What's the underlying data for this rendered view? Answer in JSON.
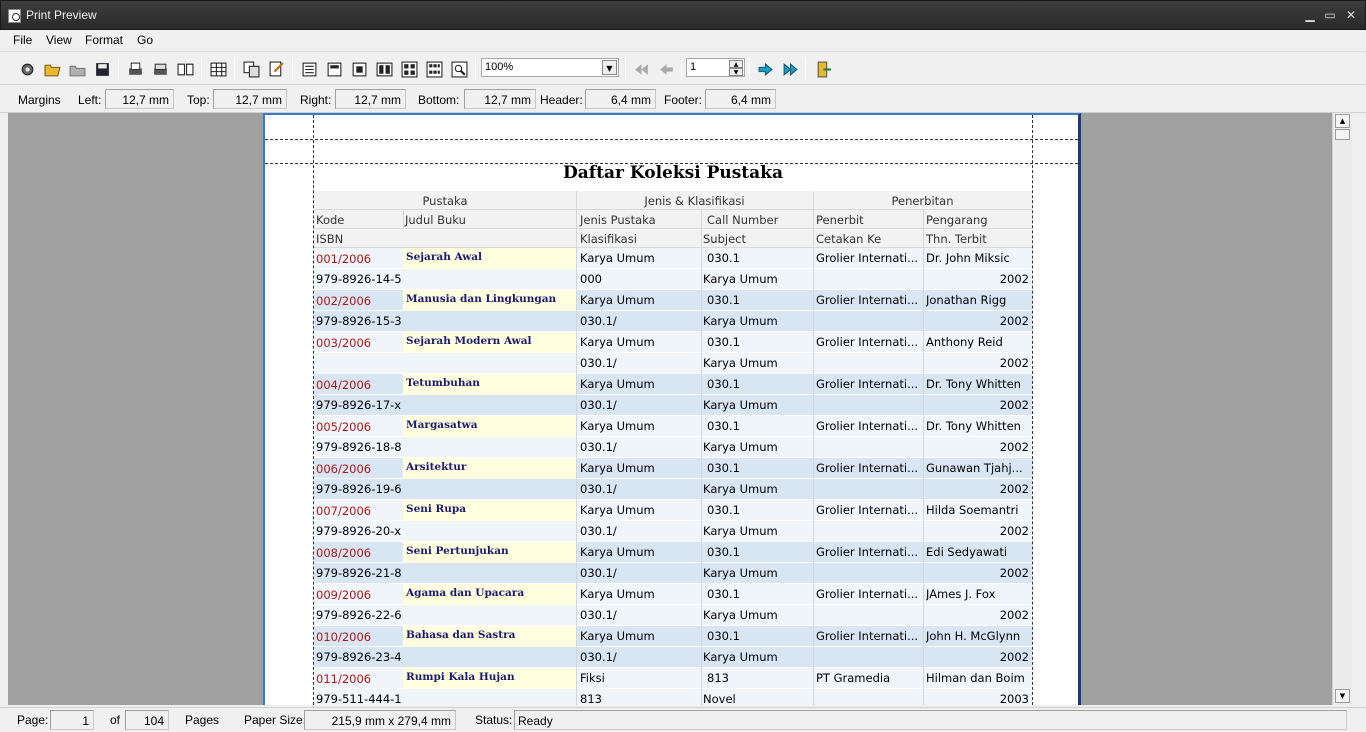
{
  "window": {
    "title": "Print Preview"
  },
  "menu": [
    "File",
    "View",
    "Format",
    "Go"
  ],
  "toolbar": {
    "zoom_value": "100%",
    "page_value": "1",
    "icons": [
      "settings-icon",
      "open-icon",
      "folder-icon",
      "save-icon",
      "print-icon",
      "print-setup-icon",
      "book-view-icon",
      "grid-icon",
      "copy-icon",
      "export-icon",
      "page-view-icon",
      "header-footer-icon",
      "single-page-icon",
      "two-pages-icon",
      "four-pages-icon",
      "multi-pages-icon",
      "zoom-fit-icon",
      "first-page-icon",
      "prev-page-icon",
      "next-page-icon",
      "last-page-icon",
      "exit-icon"
    ]
  },
  "margins": {
    "section_label": "Margins",
    "left_label": "Left:",
    "left_value": "12,7 mm",
    "top_label": "Top:",
    "top_value": "12,7 mm",
    "right_label": "Right:",
    "right_value": "12,7 mm",
    "bottom_label": "Bottom:",
    "bottom_value": "12,7 mm",
    "header_label": "Header:",
    "header_value": "6,4 mm",
    "footer_label": "Footer:",
    "footer_value": "6,4 mm"
  },
  "report": {
    "title": "Daftar Koleksi Pustaka",
    "groups": [
      "Pustaka",
      "Jenis & Klasifikasi",
      "Penerbitan"
    ],
    "header_row1": [
      "Kode",
      "Judul Buku",
      "Jenis Pustaka",
      "Call Number",
      "Penerbit",
      "Pengarang"
    ],
    "header_row2": [
      "ISBN",
      "Klasifikasi",
      "Subject",
      "Cetakan Ke",
      "Thn. Terbit"
    ],
    "records": [
      {
        "kode": "001/2006",
        "judul": "Sejarah Awal",
        "jenis": "Karya Umum",
        "call": "030.1",
        "penerbit": "Grolier Internati...",
        "pengarang": "Dr. John Miksic",
        "isbn": "979-8926-14-5",
        "klasifikasi": "000",
        "subject": "Karya Umum",
        "cetakan": "",
        "tahun": "2002"
      },
      {
        "kode": "002/2006",
        "judul": "Manusia dan Lingkungan",
        "jenis": "Karya Umum",
        "call": "030.1",
        "penerbit": "Grolier Internati...",
        "pengarang": "Jonathan Rigg",
        "isbn": "979-8926-15-3",
        "klasifikasi": "030.1/",
        "subject": "Karya Umum",
        "cetakan": "",
        "tahun": "2002"
      },
      {
        "kode": "003/2006",
        "judul": "Sejarah Modern Awal",
        "jenis": "Karya Umum",
        "call": "030.1",
        "penerbit": "Grolier Internati...",
        "pengarang": "Anthony Reid",
        "isbn": "",
        "klasifikasi": "030.1/",
        "subject": "Karya Umum",
        "cetakan": "",
        "tahun": "2002"
      },
      {
        "kode": "004/2006",
        "judul": "Tetumbuhan",
        "jenis": "Karya Umum",
        "call": "030.1",
        "penerbit": "Grolier Internati...",
        "pengarang": "Dr. Tony Whitten",
        "isbn": "979-8926-17-x",
        "klasifikasi": "030.1/",
        "subject": "Karya Umum",
        "cetakan": "",
        "tahun": "2002"
      },
      {
        "kode": "005/2006",
        "judul": "Margasatwa",
        "jenis": "Karya Umum",
        "call": "030.1",
        "penerbit": "Grolier Internati...",
        "pengarang": "Dr. Tony Whitten",
        "isbn": "979-8926-18-8",
        "klasifikasi": "030.1/",
        "subject": "Karya Umum",
        "cetakan": "",
        "tahun": "2002"
      },
      {
        "kode": "006/2006",
        "judul": "Arsitektur",
        "jenis": "Karya Umum",
        "call": "030.1",
        "penerbit": "Grolier Internati...",
        "pengarang": "Gunawan Tjahj...",
        "isbn": "979-8926-19-6",
        "klasifikasi": "030.1/",
        "subject": "Karya Umum",
        "cetakan": "",
        "tahun": "2002"
      },
      {
        "kode": "007/2006",
        "judul": "Seni Rupa",
        "jenis": "Karya Umum",
        "call": "030.1",
        "penerbit": "Grolier Internati...",
        "pengarang": "Hilda Soemantri",
        "isbn": "979-8926-20-x",
        "klasifikasi": "030.1/",
        "subject": "Karya Umum",
        "cetakan": "",
        "tahun": "2002"
      },
      {
        "kode": "008/2006",
        "judul": "Seni Pertunjukan",
        "jenis": "Karya Umum",
        "call": "030.1",
        "penerbit": "Grolier Internati...",
        "pengarang": "Edi Sedyawati",
        "isbn": "979-8926-21-8",
        "klasifikasi": "030.1/",
        "subject": "Karya Umum",
        "cetakan": "",
        "tahun": "2002"
      },
      {
        "kode": "009/2006",
        "judul": "Agama dan Upacara",
        "jenis": "Karya Umum",
        "call": "030.1",
        "penerbit": "Grolier Internati...",
        "pengarang": "JAmes J. Fox",
        "isbn": "979-8926-22-6",
        "klasifikasi": "030.1/",
        "subject": "Karya Umum",
        "cetakan": "",
        "tahun": "2002"
      },
      {
        "kode": "010/2006",
        "judul": "Bahasa dan Sastra",
        "jenis": "Karya Umum",
        "call": "030.1",
        "penerbit": "Grolier Internati...",
        "pengarang": "John H. McGlynn",
        "isbn": "979-8926-23-4",
        "klasifikasi": "030.1/",
        "subject": "Karya Umum",
        "cetakan": "",
        "tahun": "2002"
      },
      {
        "kode": "011/2006",
        "judul": "Rumpi Kala Hujan",
        "jenis": "Fiksi",
        "call": "813",
        "penerbit": "PT Gramedia",
        "pengarang": "Hilman dan Boim",
        "isbn": "979-511-444-1",
        "klasifikasi": "813",
        "subject": "Novel",
        "cetakan": "",
        "tahun": "2003"
      }
    ]
  },
  "status": {
    "page_label": "Page:",
    "page_value": "1",
    "of_label": "of",
    "total_pages": "104",
    "pages_label": "Pages",
    "paper_label": "Paper Size:",
    "paper_value": "215,9 mm x 279,4 mm",
    "status_label": "Status:",
    "status_value": "Ready"
  },
  "colors": {
    "code_text": "#b01818",
    "row_a": "#f0f5fa",
    "row_b": "#d8e6f3",
    "title_bg": "#ffffe0",
    "page_border": "#3a79c8"
  }
}
